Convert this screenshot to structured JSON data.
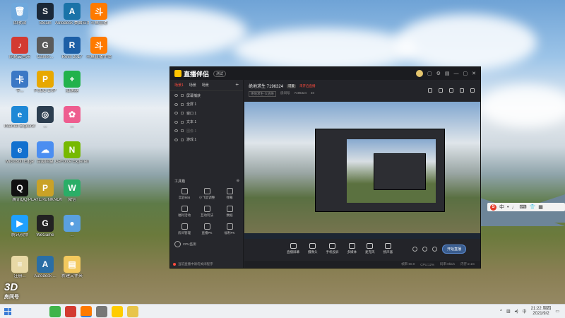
{
  "desktop": {
    "icons": [
      {
        "label": "回收站",
        "color": "#6fa8dc",
        "glyph": "🗑"
      },
      {
        "label": "Steam",
        "color": "#1b2838",
        "glyph": "S"
      },
      {
        "label": "Autodesk 桌面应用程序",
        "color": "#1a73a8",
        "glyph": "A"
      },
      {
        "label": "斗鱼直播",
        "color": "#ff7a00",
        "glyph": "斗"
      },
      {
        "label": "网易云音乐",
        "color": "#d33a31",
        "glyph": "♪"
      },
      {
        "label": "Gamer...",
        "color": "#5a5a5a",
        "glyph": "G"
      },
      {
        "label": "Revit 2017",
        "color": "#1d5fa6",
        "glyph": "R"
      },
      {
        "label": "斗鱼直播伴侣",
        "color": "#ff7a00",
        "glyph": "斗"
      },
      {
        "label": "卡...",
        "color": "#3b78c5",
        "glyph": "卡"
      },
      {
        "label": "PUBG EXP",
        "color": "#e8a800",
        "glyph": "P"
      },
      {
        "label": "加速器",
        "color": "#22b24c",
        "glyph": "+"
      },
      {
        "label": "Internet Explorer",
        "color": "#1e88d6",
        "glyph": "e"
      },
      {
        "label": "...",
        "color": "#2c3e50",
        "glyph": "◎"
      },
      {
        "label": "...",
        "color": "#ee5d8f",
        "glyph": "✿"
      },
      {
        "label": "Microsoft Edge",
        "color": "#1170cf",
        "glyph": "e"
      },
      {
        "label": "百度网盘",
        "color": "#4b8ef1",
        "glyph": "☁"
      },
      {
        "label": "GeForce Experience",
        "color": "#76b900",
        "glyph": "N"
      },
      {
        "label": "腾讯QQ",
        "color": "#111111",
        "glyph": "Q"
      },
      {
        "label": "PLAYERUNKNOWN'S BATTLEGR...",
        "color": "#c9a227",
        "glyph": "P"
      },
      {
        "label": "微信",
        "color": "#2aae67",
        "glyph": "W"
      },
      {
        "label": "腾讯视频",
        "color": "#1fa0ff",
        "glyph": "▶"
      },
      {
        "label": "WeGame",
        "color": "#222222",
        "glyph": "G"
      },
      {
        "label": "...",
        "color": "#5aa0e0",
        "glyph": "●"
      },
      {
        "label": "注册...",
        "color": "#e8d9a6",
        "glyph": "≡"
      },
      {
        "label": "Autodesk ...",
        "color": "#2a6ea5",
        "glyph": "A"
      },
      {
        "label": "新建文件夹",
        "color": "#f3c95e",
        "glyph": "▤"
      }
    ],
    "watermark": {
      "big": "3D",
      "small": "房间号"
    }
  },
  "app": {
    "title": "直播伴侣",
    "version": "测试",
    "room": {
      "name": "绝地求生 7196324",
      "tag": "可爱",
      "status": "未开启直播",
      "category": "绝地求生-大逃杀",
      "room_label": "房间号",
      "room_id": "7196324",
      "viewers": "40"
    },
    "scene_tabs": [
      "场景1",
      "场景",
      "场景"
    ],
    "sources": [
      {
        "label": "屏幕捕获",
        "dim": false
      },
      {
        "label": "全屏 1",
        "dim": false
      },
      {
        "label": "窗口 1",
        "dim": false
      },
      {
        "label": "文本 1",
        "dim": false
      },
      {
        "label": "图像 1",
        "dim": true
      },
      {
        "label": "游戏 1",
        "dim": false
      }
    ],
    "tools_title": "工具箱",
    "tools": [
      "实验666",
      "小飞鼠调整",
      "弹幕",
      "福利活动",
      "互动玩法",
      "数据",
      "房间管理",
      "直播PK",
      "福利PK"
    ],
    "more_label": "CPU监测",
    "controls": [
      "直播屏幕",
      "摄像头",
      "手机投屏",
      "多媒体",
      "麦克风",
      "扬声器"
    ],
    "start_label": "开始直播",
    "footer_hint": "当前直播中请勿关闭程序",
    "status": [
      "帧率:60.0",
      "CPU:12%",
      "码率:0kb/s",
      "内存:2.1G"
    ]
  },
  "ime": {
    "label": "中",
    "glyphs": [
      "•",
      "♩",
      "⌨",
      "👕",
      "▦"
    ]
  },
  "taskbar": {
    "time": "21:22 周四",
    "date": "2021/9/2",
    "apps": [
      "#3fb44a",
      "#d33a31",
      "#ff7a00",
      "#777777",
      "#ffcc00",
      "#e8c54a"
    ]
  }
}
